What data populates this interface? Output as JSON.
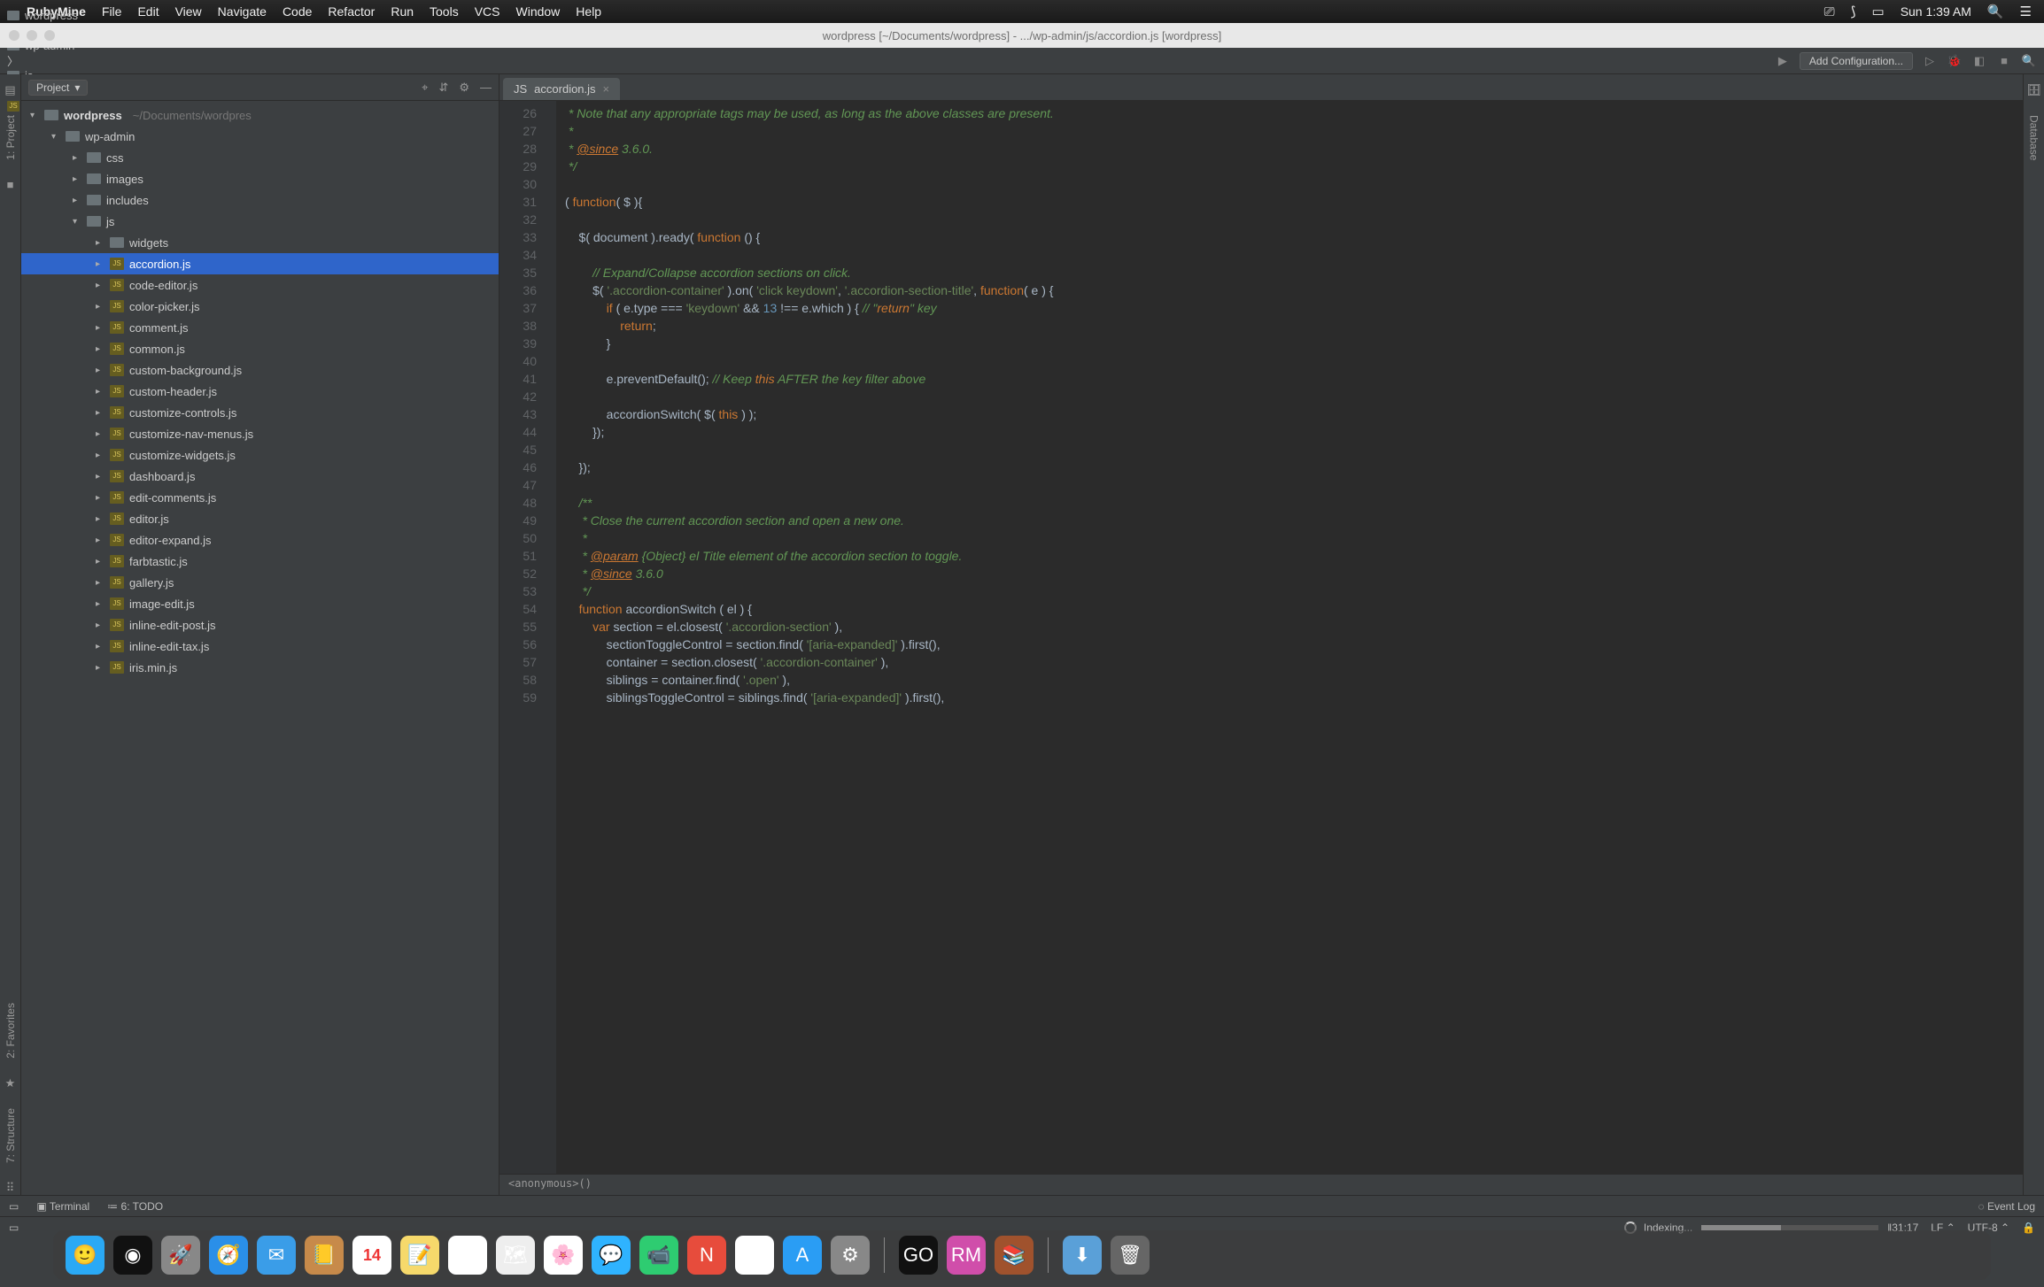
{
  "mac_menu": {
    "app": "RubyMine",
    "items": [
      "File",
      "Edit",
      "View",
      "Navigate",
      "Code",
      "Refactor",
      "Run",
      "Tools",
      "VCS",
      "Window",
      "Help"
    ],
    "clock": "Sun 1:39 AM"
  },
  "window_title": "wordpress [~/Documents/wordpress] - .../wp-admin/js/accordion.js [wordpress]",
  "breadcrumbs": [
    "wordpress",
    "wp-admin",
    "js",
    "accordion.js"
  ],
  "toolbar": {
    "add_config": "Add Configuration..."
  },
  "left_tabs": [
    "1: Project",
    "2: Favorites",
    "7: Structure"
  ],
  "right_tabs": [
    "Database"
  ],
  "project": {
    "label": "Project",
    "root": "wordpress",
    "root_path": "~/Documents/wordpres",
    "tree": [
      {
        "name": "wp-admin",
        "type": "dir",
        "depth": 1,
        "open": true
      },
      {
        "name": "css",
        "type": "dir",
        "depth": 2
      },
      {
        "name": "images",
        "type": "dir",
        "depth": 2
      },
      {
        "name": "includes",
        "type": "dir",
        "depth": 2
      },
      {
        "name": "js",
        "type": "dir",
        "depth": 2,
        "open": true
      },
      {
        "name": "widgets",
        "type": "dir",
        "depth": 3
      },
      {
        "name": "accordion.js",
        "type": "js",
        "depth": 3,
        "sel": true
      },
      {
        "name": "code-editor.js",
        "type": "js",
        "depth": 3
      },
      {
        "name": "color-picker.js",
        "type": "js",
        "depth": 3
      },
      {
        "name": "comment.js",
        "type": "js",
        "depth": 3
      },
      {
        "name": "common.js",
        "type": "js",
        "depth": 3
      },
      {
        "name": "custom-background.js",
        "type": "js",
        "depth": 3
      },
      {
        "name": "custom-header.js",
        "type": "js",
        "depth": 3
      },
      {
        "name": "customize-controls.js",
        "type": "js",
        "depth": 3
      },
      {
        "name": "customize-nav-menus.js",
        "type": "js",
        "depth": 3
      },
      {
        "name": "customize-widgets.js",
        "type": "js",
        "depth": 3
      },
      {
        "name": "dashboard.js",
        "type": "js",
        "depth": 3
      },
      {
        "name": "edit-comments.js",
        "type": "js",
        "depth": 3
      },
      {
        "name": "editor.js",
        "type": "js",
        "depth": 3
      },
      {
        "name": "editor-expand.js",
        "type": "js",
        "depth": 3
      },
      {
        "name": "farbtastic.js",
        "type": "js",
        "depth": 3
      },
      {
        "name": "gallery.js",
        "type": "js",
        "depth": 3
      },
      {
        "name": "image-edit.js",
        "type": "js",
        "depth": 3
      },
      {
        "name": "inline-edit-post.js",
        "type": "js",
        "depth": 3
      },
      {
        "name": "inline-edit-tax.js",
        "type": "js",
        "depth": 3
      },
      {
        "name": "iris.min.js",
        "type": "js",
        "depth": 3
      }
    ]
  },
  "editor": {
    "tab": "accordion.js",
    "first_line": 26,
    "lines": [
      " * Note that any appropriate tags may be used, as long as the above classes are present.",
      " *",
      " * @since 3.6.0.",
      " */",
      "",
      "( function( $ ){",
      "",
      "    $( document ).ready( function () {",
      "",
      "        // Expand/Collapse accordion sections on click.",
      "        $( '.accordion-container' ).on( 'click keydown', '.accordion-section-title', function( e ) {",
      "            if ( e.type === 'keydown' && 13 !== e.which ) { // \"return\" key",
      "                return;",
      "            }",
      "",
      "            e.preventDefault(); // Keep this AFTER the key filter above",
      "",
      "            accordionSwitch( $( this ) );",
      "        });",
      "",
      "    });",
      "",
      "    /**",
      "     * Close the current accordion section and open a new one.",
      "     *",
      "     * @param {Object} el Title element of the accordion section to toggle.",
      "     * @since 3.6.0",
      "     */",
      "    function accordionSwitch ( el ) {",
      "        var section = el.closest( '.accordion-section' ),",
      "            sectionToggleControl = section.find( '[aria-expanded]' ).first(),",
      "            container = section.closest( '.accordion-container' ),",
      "            siblings = container.find( '.open' ),",
      "            siblingsToggleControl = siblings.find( '[aria-expanded]' ).first(),"
    ],
    "breadcrumb": "<anonymous>()"
  },
  "bottom": {
    "terminal": "Terminal",
    "todo": "6: TODO",
    "eventlog": "Event Log"
  },
  "status": {
    "indexing": "Indexing...",
    "pos": "31:17",
    "lineend": "LF",
    "encoding": "UTF-8"
  },
  "dock": [
    {
      "n": "finder",
      "c": "#2aa9f5",
      "g": "🙂"
    },
    {
      "n": "siri",
      "c": "#111",
      "g": "◉"
    },
    {
      "n": "launchpad",
      "c": "#888",
      "g": "🚀"
    },
    {
      "n": "safari",
      "c": "#2a8fe8",
      "g": "🧭"
    },
    {
      "n": "mail",
      "c": "#3a9de8",
      "g": "✉"
    },
    {
      "n": "contacts",
      "c": "#c78a4a",
      "g": "📒"
    },
    {
      "n": "calendar",
      "c": "#fff",
      "g": "14"
    },
    {
      "n": "notes",
      "c": "#f6d96b",
      "g": "📝"
    },
    {
      "n": "reminders",
      "c": "#fff",
      "g": "☑"
    },
    {
      "n": "maps",
      "c": "#eee",
      "g": "🗺"
    },
    {
      "n": "photos",
      "c": "#fff",
      "g": "🌸"
    },
    {
      "n": "messages",
      "c": "#2fb3ff",
      "g": "💬"
    },
    {
      "n": "facetime",
      "c": "#2ecc71",
      "g": "📹"
    },
    {
      "n": "news",
      "c": "#e74c3c",
      "g": "N"
    },
    {
      "n": "itunes",
      "c": "#fff",
      "g": "♪"
    },
    {
      "n": "appstore",
      "c": "#2a9df4",
      "g": "A"
    },
    {
      "n": "settings",
      "c": "#888",
      "g": "⚙"
    },
    {
      "n": "goland",
      "c": "#111",
      "g": "GO"
    },
    {
      "n": "rubymine",
      "c": "#d04eaa",
      "g": "RM"
    },
    {
      "n": "books",
      "c": "#a0522d",
      "g": "📚"
    },
    {
      "n": "downloads",
      "c": "#5aa0d8",
      "g": "⬇"
    },
    {
      "n": "trash",
      "c": "#666",
      "g": "🗑"
    }
  ]
}
